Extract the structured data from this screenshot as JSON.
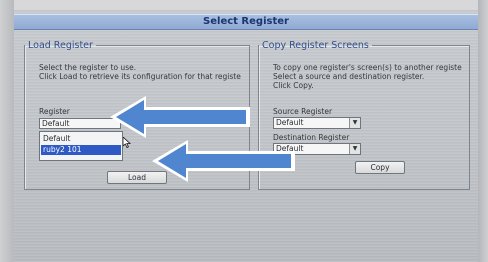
{
  "window": {
    "title": "Select Register"
  },
  "load_group": {
    "legend": "Load Register",
    "instructions": [
      "Select the register to use.",
      "Click Load to retrieve its configuration for that registe"
    ],
    "register_label": "Register",
    "register_input_value": "Default",
    "list_items": [
      "Default",
      "ruby2 101"
    ],
    "selected_item": "ruby2 101",
    "load_button_label": "Load"
  },
  "copy_group": {
    "legend": "Copy Register Screens",
    "instructions": [
      "To copy one register's screen(s) to another registe",
      "Select a source and destination register.",
      "Click Copy."
    ],
    "source_label": "Source Register",
    "source_value": "Default",
    "destination_label": "Destination Register",
    "destination_value": "Default",
    "copy_button_label": "Copy"
  },
  "annotation": {
    "arrow_color": "#4f86cf"
  }
}
